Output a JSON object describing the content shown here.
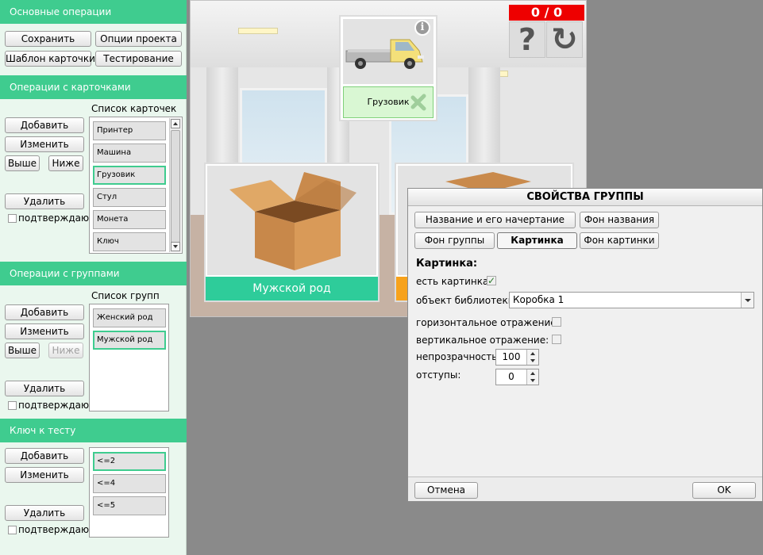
{
  "left_panel": {
    "main_ops": {
      "header": "Основные операции",
      "save": "Сохранить",
      "project_options": "Опции проекта",
      "card_template": "Шаблон карточки",
      "testing": "Тестирование"
    },
    "card_ops": {
      "header": "Операции с карточками",
      "list_title": "Список карточек",
      "add": "Добавить",
      "edit": "Изменить",
      "up": "Выше",
      "down": "Ниже",
      "delete": "Удалить",
      "confirm": "подтверждаю",
      "items": [
        "Принтер",
        "Машина",
        "Грузовик",
        "Стул",
        "Монета",
        "Ключ"
      ]
    },
    "group_ops": {
      "header": "Операции с группами",
      "list_title": "Список групп",
      "add": "Добавить",
      "edit": "Изменить",
      "up": "Выше",
      "down": "Ниже",
      "delete": "Удалить",
      "confirm": "подтверждаю",
      "items": [
        "Женский род",
        "Мужской род"
      ]
    },
    "key_ops": {
      "header": "Ключ к тесту",
      "add": "Добавить",
      "edit": "Изменить",
      "delete": "Удалить",
      "confirm": "подтверждаю",
      "items": [
        "<=2",
        "<=4",
        "<=5"
      ]
    }
  },
  "stage": {
    "score": "0 / 0",
    "help_glyph": "?",
    "reset_glyph": "↻",
    "info_glyph": "i",
    "card_top_caption": "Грузовик",
    "group_left_caption": "Мужской род",
    "colors": {
      "group_left": "#2ecc9a",
      "group_right": "#f7a21c",
      "card_caption_bg": "#d9f7d3",
      "accent": "#3fcc8f"
    }
  },
  "dialog": {
    "title": "СВОЙСТВА ГРУППЫ",
    "tabs": {
      "name_style": "Название и его начертание",
      "name_bg": "Фон названия",
      "group_bg": "Фон группы",
      "picture": "Картинка",
      "picture_bg": "Фон картинки"
    },
    "section": "Картинка:",
    "has_picture_label": "есть картинка:",
    "has_picture": true,
    "check_mark": "✓",
    "library_label": "объект библиотеки:",
    "library_value": "Коробка 1",
    "hflip_label": "горизонтальное отражение:",
    "vflip_label": "вертикальное отражение:",
    "opacity_label": "непрозрачность:",
    "opacity_value": "100",
    "margins_label": "отступы:",
    "margins_value": "0",
    "cancel": "Отмена",
    "ok": "OK"
  }
}
